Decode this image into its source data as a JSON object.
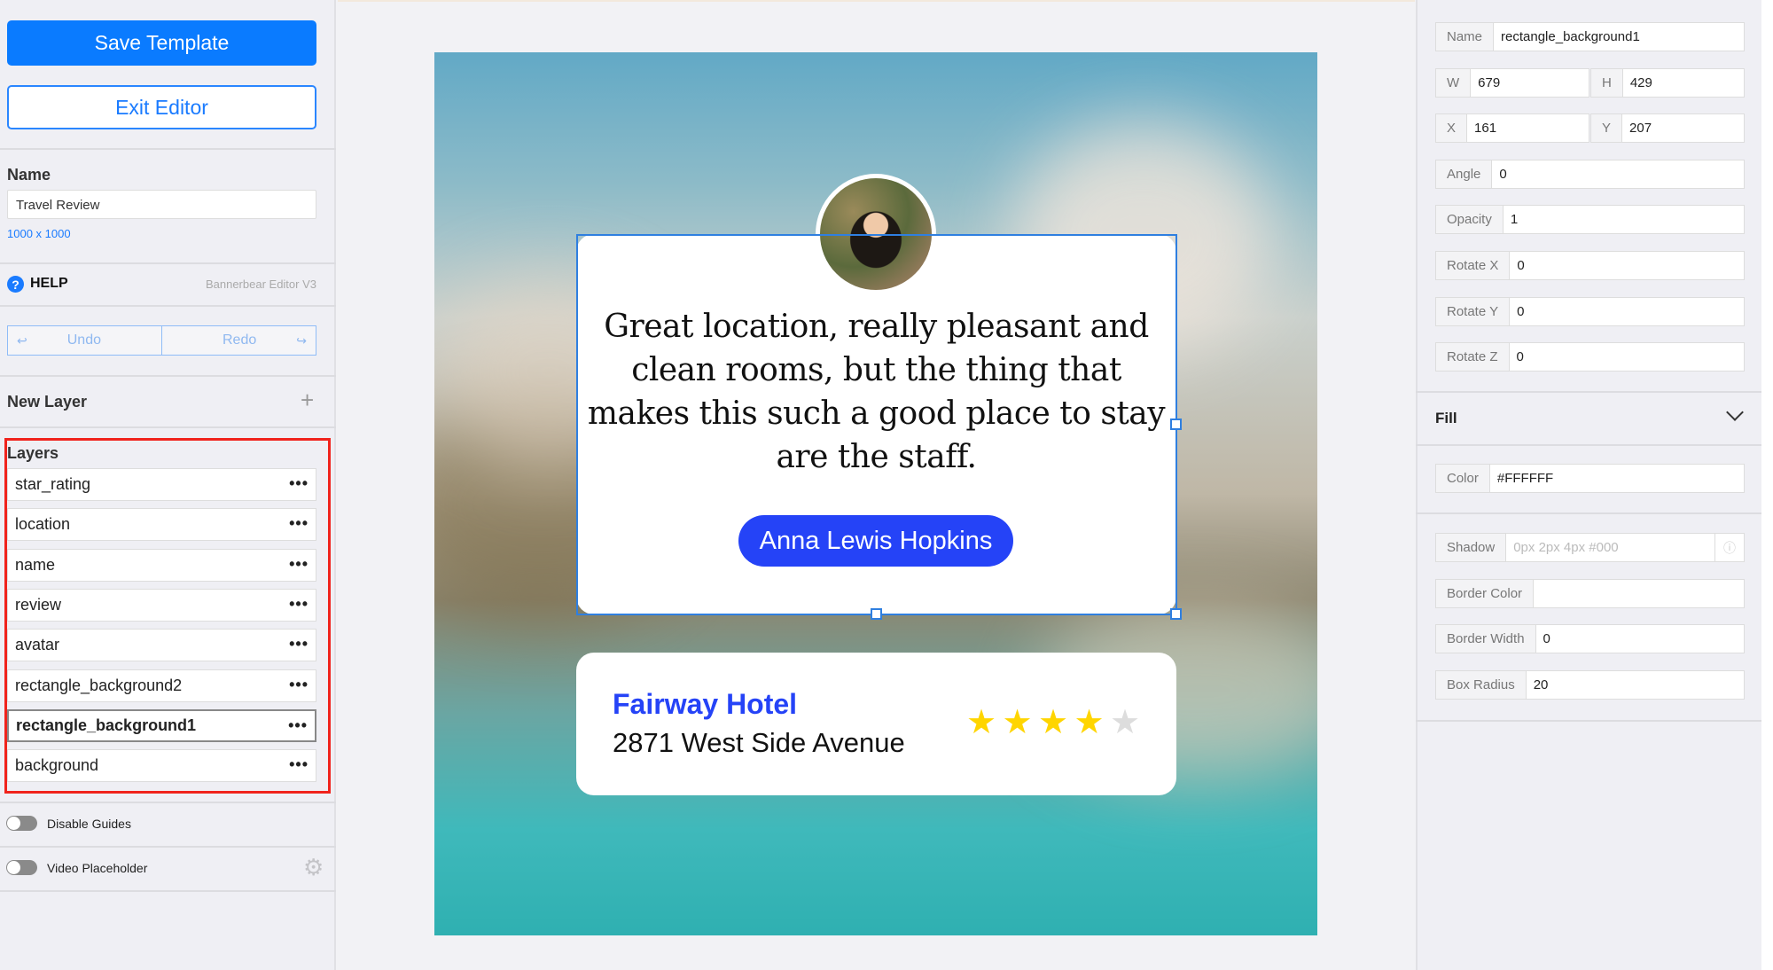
{
  "left_panel": {
    "save_label": "Save Template",
    "exit_label": "Exit Editor",
    "name_label": "Name",
    "name_value": "Travel Review",
    "dimensions": "1000 x 1000",
    "help_label": "HELP",
    "editor_version": "Bannerbear Editor V3",
    "undo_label": "Undo",
    "redo_label": "Redo",
    "new_layer_label": "New Layer",
    "layers_label": "Layers",
    "layers": [
      {
        "name": "star_rating"
      },
      {
        "name": "location"
      },
      {
        "name": "name"
      },
      {
        "name": "review"
      },
      {
        "name": "avatar"
      },
      {
        "name": "rectangle_background2"
      },
      {
        "name": "rectangle_background1",
        "selected": true
      },
      {
        "name": "background"
      }
    ],
    "more_glyph": "•••",
    "disable_guides_label": "Disable Guides",
    "disable_guides_on": false,
    "video_placeholder_label": "Video Placeholder",
    "video_placeholder_on": false
  },
  "canvas": {
    "review": "Great location, really pleasant and clean rooms, but the thing that makes this such a good place to stay are the staff.",
    "reviewer_name": "Anna Lewis Hopkins",
    "hotel_name": "Fairway Hotel",
    "address": "2871 West Side Avenue",
    "rating": 4,
    "rating_max": 5,
    "colors": {
      "accent": "#2543F7",
      "star": "#FFD500",
      "star_empty": "#DDDDDD"
    }
  },
  "right_panel": {
    "name": {
      "label": "Name",
      "value": "rectangle_background1"
    },
    "w": {
      "label": "W",
      "value": "679"
    },
    "h": {
      "label": "H",
      "value": "429"
    },
    "x": {
      "label": "X",
      "value": "161"
    },
    "y": {
      "label": "Y",
      "value": "207"
    },
    "angle": {
      "label": "Angle",
      "value": "0"
    },
    "opacity": {
      "label": "Opacity",
      "value": "1"
    },
    "rotate_x": {
      "label": "Rotate X",
      "value": "0"
    },
    "rotate_y": {
      "label": "Rotate Y",
      "value": "0"
    },
    "rotate_z": {
      "label": "Rotate Z",
      "value": "0"
    },
    "fill_label": "Fill",
    "color": {
      "label": "Color",
      "value": "#FFFFFF"
    },
    "shadow": {
      "label": "Shadow",
      "placeholder": "0px 2px 4px #000"
    },
    "border_color": {
      "label": "Border Color",
      "value": ""
    },
    "border_width": {
      "label": "Border Width",
      "value": "0"
    },
    "box_radius": {
      "label": "Box Radius",
      "value": "20"
    }
  }
}
